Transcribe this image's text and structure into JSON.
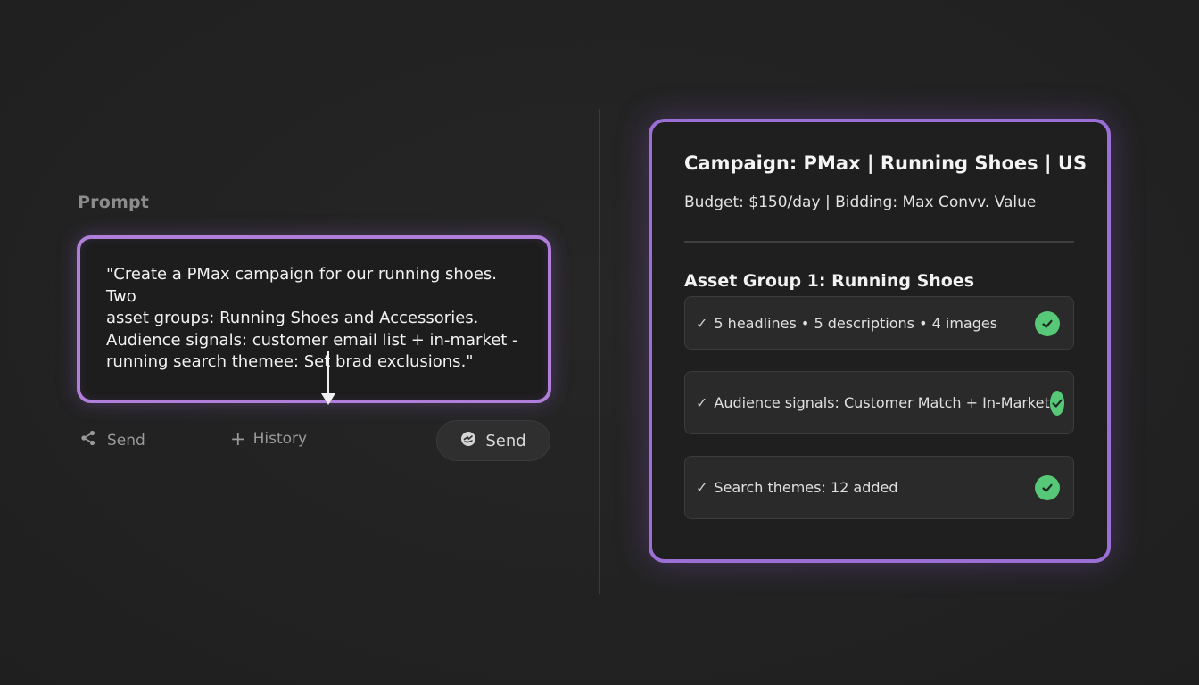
{
  "prompt": {
    "label": "Prompt",
    "text": "\"Create a PMax campaign for our running shoes. Two\n asset groups: Running Shoes and Accessories.\nAudience signals: customer email list + in-market -\nrunning search themee: Set brad exclusions.\""
  },
  "actions": {
    "share_label": "Send",
    "history_label": "History",
    "send_label": "Send"
  },
  "campaign": {
    "title": "Campaign: PMax | Running Shoes | US",
    "meta": "Budget: $150/day | Bidding: Max Convv. Value",
    "asset_group_title": "Asset Group 1: Running Shoes",
    "rows": [
      {
        "label": "5 headlines • 5 descriptions • 4 images"
      },
      {
        "label": "Audience signals: Customer Match + In-Market"
      },
      {
        "label": "Search themes: 12 added"
      }
    ]
  },
  "icons": {
    "share": "share-icon",
    "history": "plus-icon",
    "send": "send-icon",
    "row_check": "checkmark-icon",
    "row_status": "check-circle-icon"
  },
  "colors": {
    "accent_purple": "#b07fd9",
    "success_green": "#57c878",
    "background": "#232323"
  }
}
